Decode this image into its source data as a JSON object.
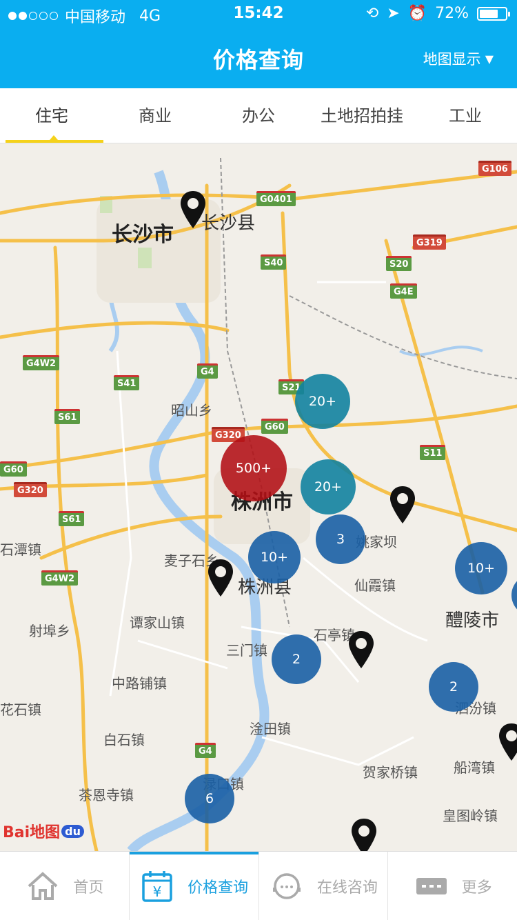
{
  "status_bar": {
    "carrier": "中国移动",
    "network": "4G",
    "time": "15:42",
    "battery": "72%",
    "battery_level": 0.72,
    "signal_bars_filled": 2
  },
  "header": {
    "title": "价格查询",
    "map_toggle": "地图显示",
    "background_color": "#0aaef0"
  },
  "tabs": [
    {
      "label": "住宅",
      "active": true
    },
    {
      "label": "商业",
      "active": false
    },
    {
      "label": "办公",
      "active": false
    },
    {
      "label": "土地招拍挂",
      "active": false
    },
    {
      "label": "工业",
      "active": false
    }
  ],
  "map": {
    "cities": [
      "长沙市",
      "长沙县",
      "株洲市",
      "株洲县",
      "醴陵市"
    ],
    "places": [
      "昭山乡",
      "麦子石乡",
      "姚家坝",
      "仙霞镇",
      "谭家山镇",
      "射埠乡",
      "石亭镇",
      "三门镇",
      "中路铺镇",
      "花石镇",
      "白石镇",
      "淦田镇",
      "贺家桥镇",
      "茶恩寺镇",
      "渌口镇",
      "泗汾镇",
      "船湾镇",
      "皇图岭镇",
      "石潭镇"
    ],
    "road_shields": [
      "G106",
      "G0401",
      "G319",
      "S40",
      "S20",
      "G4E",
      "G4W2",
      "S41",
      "G4",
      "S21",
      "S61",
      "G60",
      "G320",
      "S11",
      "S61",
      "G4W2",
      "G4",
      "G60",
      "G320"
    ],
    "clusters": [
      "20+",
      "500+",
      "20+",
      "3",
      "10+",
      "10+",
      "2",
      "2",
      "6"
    ],
    "logo": "Bai地图",
    "logo_du": "du"
  },
  "bottom_nav": [
    {
      "label": "首页",
      "icon": "home-icon",
      "active": false
    },
    {
      "label": "价格查询",
      "icon": "price-calendar-icon",
      "active": true
    },
    {
      "label": "在线咨询",
      "icon": "chat-headset-icon",
      "active": false
    },
    {
      "label": "更多",
      "icon": "more-icon",
      "active": false
    }
  ],
  "colors": {
    "accent": "#1aa0df",
    "tab_indicator": "#f5d21a",
    "cluster_hot": "#b20f14"
  }
}
